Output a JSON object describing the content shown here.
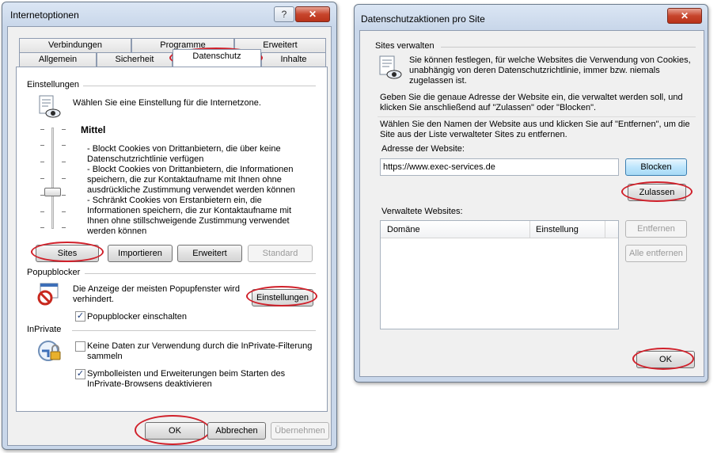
{
  "left": {
    "title": "Internetoptionen",
    "help": "?",
    "close": "✕",
    "tabs_top": [
      "Verbindungen",
      "Programme",
      "Erweitert"
    ],
    "tabs_bottom": [
      "Allgemein",
      "Sicherheit",
      "Datenschutz",
      "Inhalte"
    ],
    "settings_group": "Einstellungen",
    "settings_intro": "Wählen Sie eine Einstellung für die Internetzone.",
    "level": "Mittel",
    "level_desc": [
      "- Blockt Cookies von Drittanbietern, die über keine",
      "Datenschutzrichtlinie verfügen",
      "- Blockt Cookies von Drittanbietern, die Informationen",
      "speichern, die zur Kontaktaufname mit Ihnen ohne",
      "ausdrückliche Zustimmung verwendet werden können",
      "- Schränkt Cookies von Erstanbietern ein, die",
      "Informationen speichern, die zur Kontaktaufname mit",
      "Ihnen ohne stillschweigende Zustimmung verwendet",
      "werden können"
    ],
    "btn_sites": "Sites",
    "btn_import": "Importieren",
    "btn_advanced": "Erweitert",
    "btn_default": "Standard",
    "popup_group": "Popupblocker",
    "popup_desc_1": "Die Anzeige der meisten Popupfenster wird",
    "popup_desc_2": "verhindert.",
    "btn_popup_settings": "Einstellungen",
    "popup_checkbox": "Popupblocker einschalten",
    "inprivate_group": "InPrivate",
    "inprivate_chk1_1": "Keine Daten zur Verwendung durch die InPrivate-Filterung",
    "inprivate_chk1_2": "sammeln",
    "inprivate_chk2_1": "Symbolleisten und Erweiterungen beim Starten des",
    "inprivate_chk2_2": "InPrivate-Browsens deaktivieren",
    "btn_ok": "OK",
    "btn_cancel": "Abbrechen",
    "btn_apply": "Übernehmen",
    "check_mark": "✓"
  },
  "right": {
    "title": "Datenschutzaktionen pro Site",
    "close": "✕",
    "group": "Sites verwalten",
    "intro_1": "Sie können festlegen, für welche Websites die Verwendung von Cookies,",
    "intro_2": "unabhängig von deren Datenschutzrichtlinie, immer bzw. niemals",
    "intro_3": "zugelassen ist.",
    "instr1_1": "Geben Sie die genaue Adresse der Website ein, die verwaltet werden soll, und",
    "instr1_2": "klicken Sie anschließend auf \"Zulassen\" oder \"Blocken\".",
    "instr2_1": "Wählen Sie den Namen der Website aus und klicken Sie auf \"Entfernen\", um die",
    "instr2_2": "Site aus der Liste verwalteter Sites zu entfernen.",
    "address_label": "Adresse der Website:",
    "address_value": "https://www.exec-services.de",
    "btn_block": "Blocken",
    "btn_allow": "Zulassen",
    "managed_label": "Verwaltete Websites:",
    "col_domain": "Domäne",
    "col_setting": "Einstellung",
    "btn_remove": "Entfernen",
    "btn_remove_all": "Alle entfernen",
    "btn_ok": "OK"
  }
}
